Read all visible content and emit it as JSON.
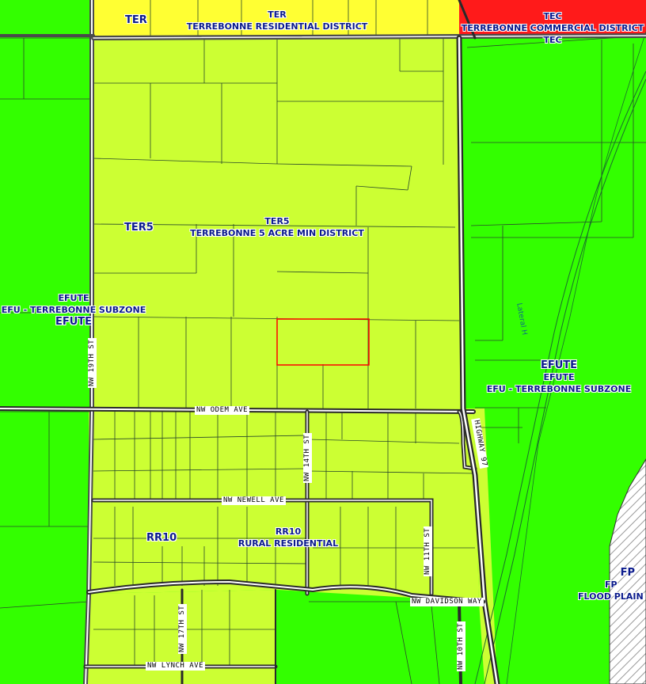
{
  "map": {
    "colors": {
      "ter": "#ffff33",
      "tec": "#ff1a1a",
      "ter5": "#ccff33",
      "efute": "#33ff00",
      "rr10": "#ccff33",
      "fp": "#ffffff",
      "selected_parcel": "#ff0000",
      "label_text": "#0a1a8c",
      "road": "#4a4a4a"
    },
    "zones": {
      "ter": {
        "code": "TER",
        "code2": "TER",
        "name": "TERREBONNE RESIDENTIAL DISTRICT"
      },
      "tec": {
        "code": "TEC",
        "name": "TERREBONNE COMMERCIAL DISTRICT",
        "code2": "TEC"
      },
      "ter5": {
        "code": "TER5",
        "code2": "TER5",
        "name": "TERREBONNE 5 ACRE MIN DISTRICT"
      },
      "efute_west": {
        "code": "EFUTE",
        "name": "EFU - TERREBONNE SUBZONE",
        "code2": "EFUTE"
      },
      "efute_east": {
        "code": "EFUTE",
        "code2": "EFUTE",
        "name": "EFU - TERREBONNE SUBZONE"
      },
      "rr10": {
        "code": "RR10",
        "code2": "RR10",
        "name": "RURAL RESIDENTIAL"
      },
      "fp": {
        "code": "FP",
        "code2": "FP",
        "name": "FLOOD PLAIN"
      }
    },
    "roads": {
      "nw_19th": "NW 19TH ST",
      "nw_odem": "NW ODEM AVE",
      "nw_14th": "NW 14TH ST",
      "highway_97": "HIGHWAY 97",
      "nw_newell": "NW NEWELL AVE",
      "nw_11th": "NW 11TH ST",
      "nw_davidson": "NW DAVIDSON WAY",
      "nw_17th": "NW 17TH ST",
      "nw_10th": "NW 10TH ST",
      "nw_lynch": "NW LYNCH AVE"
    },
    "features": {
      "lateral": "Lateral H"
    }
  }
}
